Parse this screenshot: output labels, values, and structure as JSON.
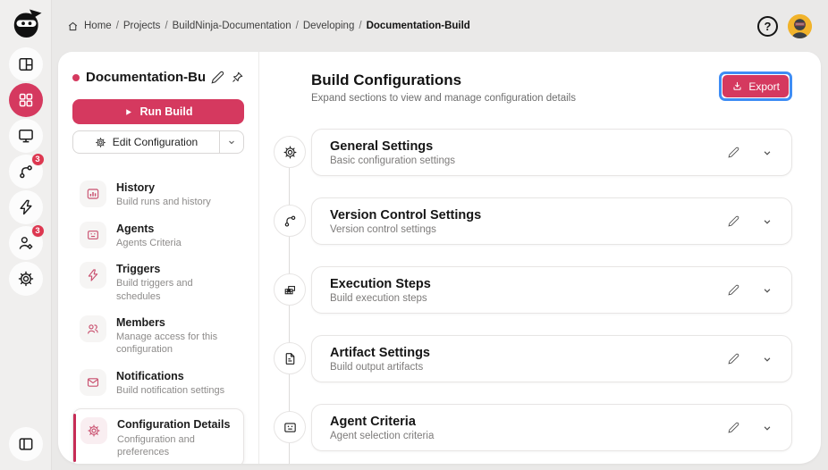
{
  "colors": {
    "accent": "#d5395f",
    "badge": "#dd3750",
    "focus_ring": "#3e8df5",
    "avatar_bg": "#f1b32b",
    "selected_bar": "#c62b55"
  },
  "rail": {
    "badges": {
      "pipelines": "3",
      "users": "3"
    }
  },
  "breadcrumb": {
    "separator": "/",
    "items": [
      "Home",
      "Projects",
      "BuildNinja-Documentation",
      "Developing",
      "Documentation-Build"
    ]
  },
  "topbar": {
    "help_label": "?"
  },
  "sidebar": {
    "project_name": "Documentation-Bu...",
    "run_build": "Run Build",
    "edit_configuration": "Edit Configuration",
    "items": [
      {
        "icon": "history-chart-icon",
        "label": "History",
        "description": "Build runs and history"
      },
      {
        "icon": "agents-terminal-icon",
        "label": "Agents",
        "description": "Agents Criteria"
      },
      {
        "icon": "bolt-icon",
        "label": "Triggers",
        "description": "Build triggers and schedules"
      },
      {
        "icon": "users-icon",
        "label": "Members",
        "description": "Manage access for this configuration"
      },
      {
        "icon": "envelope-icon",
        "label": "Notifications",
        "description": "Build notification settings"
      },
      {
        "icon": "gear-icon",
        "label": "Configuration Details",
        "description": "Configuration and preferences",
        "selected": true
      }
    ]
  },
  "main": {
    "title": "Build Configurations",
    "subtitle": "Expand sections to view and manage configuration details",
    "export_label": "Export",
    "sections": [
      {
        "icon": "gear-icon",
        "title": "General Settings",
        "subtitle": "Basic configuration settings"
      },
      {
        "icon": "git-branch-icon",
        "title": "Version Control Settings",
        "subtitle": "Version control settings"
      },
      {
        "icon": "steps-table-icon",
        "title": "Execution Steps",
        "subtitle": "Build execution steps"
      },
      {
        "icon": "file-icon",
        "title": "Artifact Settings",
        "subtitle": "Build output artifacts"
      },
      {
        "icon": "agent-terminal-icon",
        "title": "Agent Criteria",
        "subtitle": "Agent selection criteria"
      }
    ]
  }
}
